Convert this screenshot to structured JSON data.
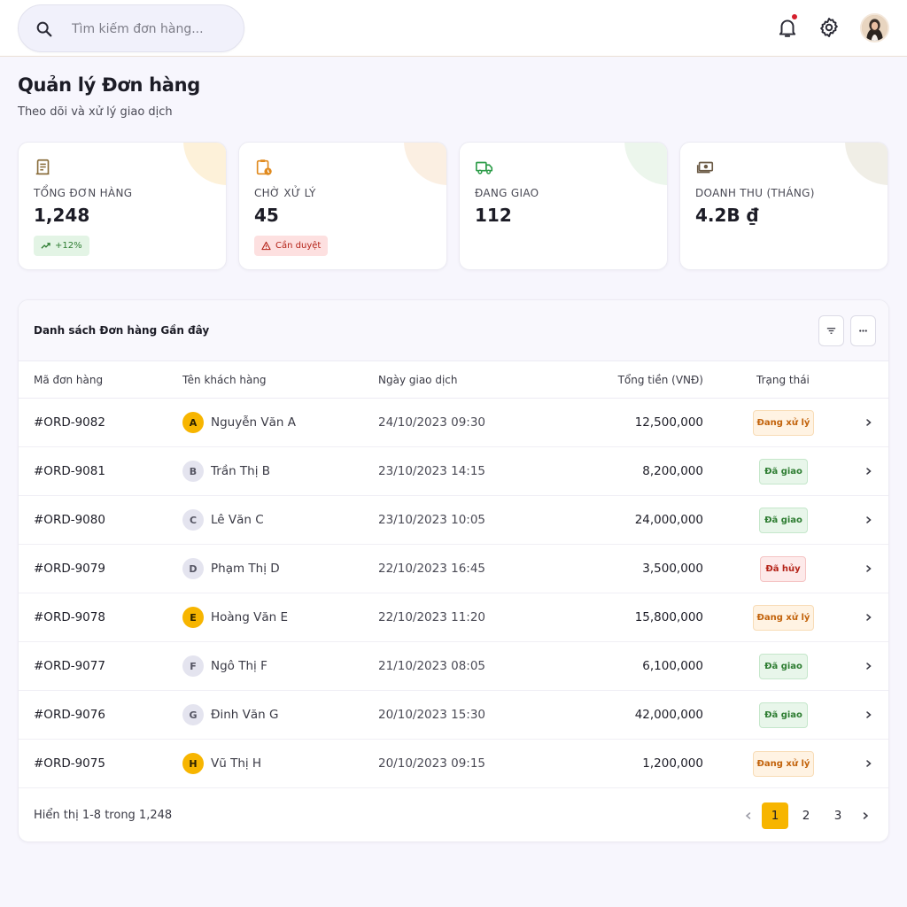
{
  "search": {
    "placeholder": "Tìm kiếm đơn hàng..."
  },
  "header": {
    "title": "Quản lý Đơn hàng",
    "subtitle": "Theo dõi và xử lý giao dịch"
  },
  "stats": [
    {
      "label": "TỔNG ĐƠN HÀNG",
      "value": "1,248",
      "badge": "+12%",
      "icon": "receipt-icon"
    },
    {
      "label": "CHỜ XỬ LÝ",
      "value": "45",
      "badge": "Cần duyệt",
      "icon": "clipboard-clock-icon"
    },
    {
      "label": "ĐANG GIAO",
      "value": "112",
      "icon": "truck-icon"
    },
    {
      "label": "DOANH THU (THÁNG)",
      "value": "4.2B ₫",
      "icon": "cash-icon"
    }
  ],
  "table": {
    "title": "Danh sách Đơn hàng Gần đây",
    "columns": [
      "Mã đơn hàng",
      "Tên khách hàng",
      "Ngày giao dịch",
      "Tổng tiền (VNĐ)",
      "Trạng thái"
    ],
    "rows": [
      {
        "id": "#ORD-9082",
        "initial": "A",
        "name": "Nguyễn Văn A",
        "date": "24/10/2023 09:30",
        "amount": "12,500,000",
        "status": "Đang xử lý"
      },
      {
        "id": "#ORD-9081",
        "initial": "B",
        "name": "Trần Thị B",
        "date": "23/10/2023 14:15",
        "amount": "8,200,000",
        "status": "Đã giao"
      },
      {
        "id": "#ORD-9080",
        "initial": "C",
        "name": "Lê Văn C",
        "date": "23/10/2023 10:05",
        "amount": "24,000,000",
        "status": "Đã giao"
      },
      {
        "id": "#ORD-9079",
        "initial": "D",
        "name": "Phạm Thị D",
        "date": "22/10/2023 16:45",
        "amount": "3,500,000",
        "status": "Đã hủy"
      },
      {
        "id": "#ORD-9078",
        "initial": "E",
        "name": "Hoàng Văn E",
        "date": "22/10/2023 11:20",
        "amount": "15,800,000",
        "status": "Đang xử lý"
      },
      {
        "id": "#ORD-9077",
        "initial": "F",
        "name": "Ngô Thị F",
        "date": "21/10/2023 08:05",
        "amount": "6,100,000",
        "status": "Đã giao"
      },
      {
        "id": "#ORD-9076",
        "initial": "G",
        "name": "Đinh Văn G",
        "date": "20/10/2023 15:30",
        "amount": "42,000,000",
        "status": "Đã giao"
      },
      {
        "id": "#ORD-9075",
        "initial": "H",
        "name": "Vũ Thị H",
        "date": "20/10/2023 09:15",
        "amount": "1,200,000",
        "status": "Đang xử lý"
      }
    ],
    "footer": "Hiển thị 1-8 trong 1,248",
    "pages": [
      "1",
      "2",
      "3"
    ]
  },
  "colors": {
    "accent": "#f7b500",
    "notification": "#d51f2d",
    "success": "#2e7d32",
    "danger": "#b42318",
    "processing": "#c2620a"
  }
}
